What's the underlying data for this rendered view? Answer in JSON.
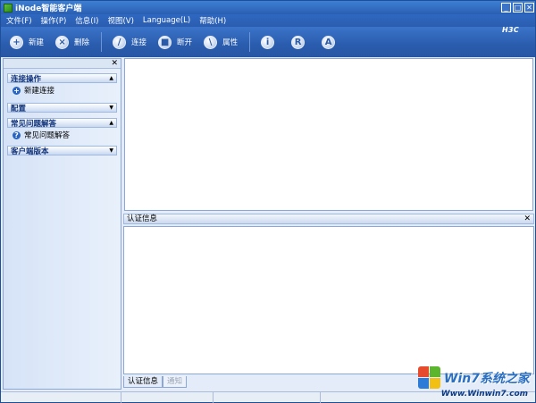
{
  "window": {
    "title": "iNode智能客户端",
    "brand": "H3C",
    "min_label": "_",
    "max_label": "□",
    "close_label": "✕"
  },
  "menubar": {
    "items": [
      "文件(F)",
      "操作(P)",
      "信息(I)",
      "视图(V)",
      "Language(L)",
      "帮助(H)"
    ]
  },
  "toolbar": {
    "new_label": "新建",
    "delete_label": "删除",
    "connect_label": "连接",
    "disconnect_label": "断开",
    "properties_label": "属性",
    "info_glyph": "i",
    "r_glyph": "R",
    "a_glyph": "A"
  },
  "left_panel": {
    "close_label": "✕",
    "sections": [
      {
        "title": "连接操作",
        "items": [
          "新建连接"
        ]
      },
      {
        "title": "配置",
        "items": []
      },
      {
        "title": "常见问题解答",
        "items": [
          "常见问题解答"
        ]
      },
      {
        "title": "客户端版本",
        "items": []
      }
    ]
  },
  "bottom_panel": {
    "title": "认证信息",
    "close_label": "✕",
    "tabs": [
      "认证信息",
      "通知"
    ]
  },
  "watermark": {
    "text": "Win7系统之家",
    "url": "Www.Winwin7.com"
  },
  "colors": {
    "titlebar": "#2a5fb3",
    "toolbar": "#2a5cad",
    "panel_bg": "#e3ecf8",
    "section_title": "#11337a"
  }
}
